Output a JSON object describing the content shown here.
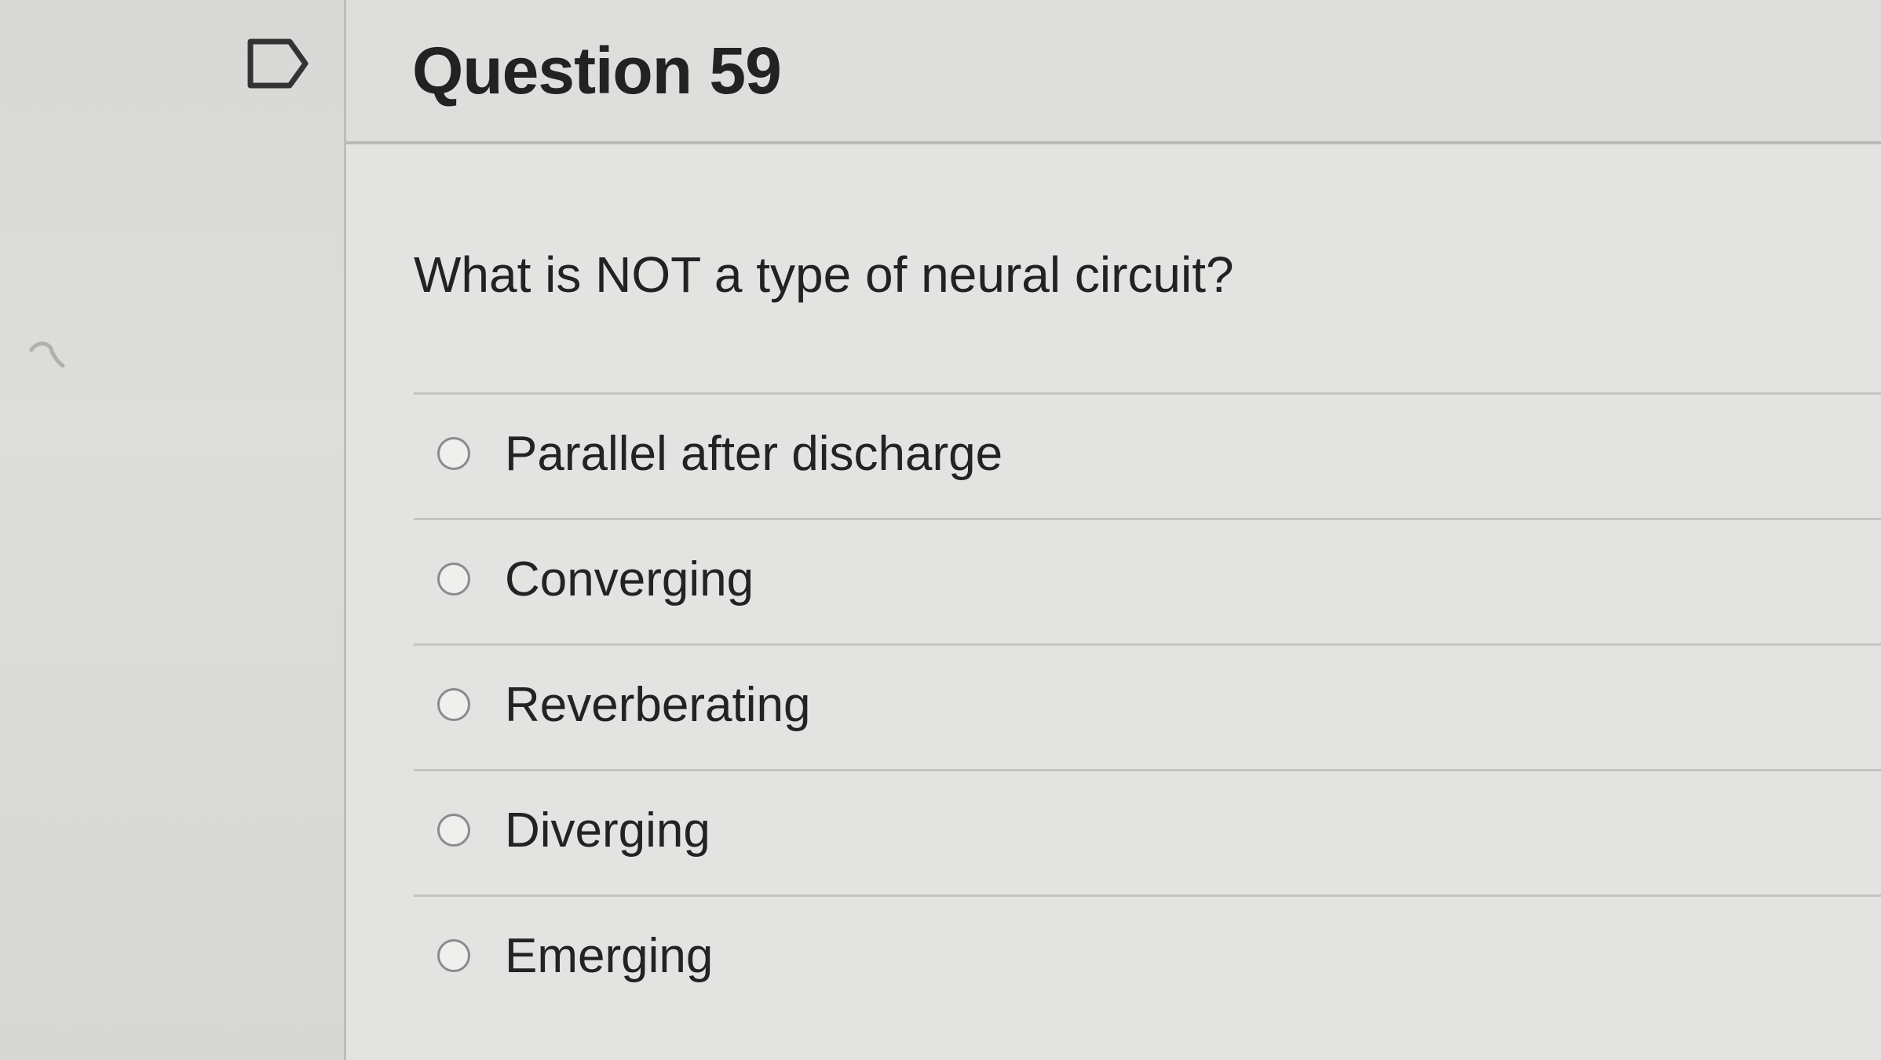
{
  "question": {
    "title": "Question 59",
    "prompt": "What is NOT a type of neural circuit?",
    "options": [
      {
        "label": "Parallel after discharge",
        "selected": false
      },
      {
        "label": "Converging",
        "selected": false
      },
      {
        "label": "Reverberating",
        "selected": false
      },
      {
        "label": "Diverging",
        "selected": false
      },
      {
        "label": "Emerging",
        "selected": false
      }
    ]
  },
  "icons": {
    "flag": "flag-icon",
    "radio": "radio-button"
  },
  "colors": {
    "background": "#dcdcdc",
    "text": "#222222",
    "divider": "#c4c4c2",
    "radio_border": "#8b8b8b"
  }
}
